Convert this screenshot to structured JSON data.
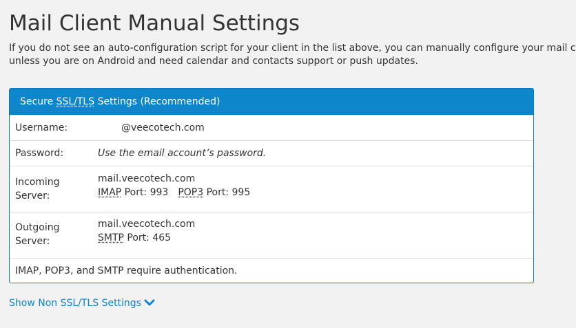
{
  "page": {
    "title": "Mail Client Manual Settings",
    "description_line1": "If you do not see an auto-configuration script for your client in the list above, you can manually configure your mail client using",
    "description_line2": "unless you are on Android and need calendar and contacts support or push updates."
  },
  "panel": {
    "header_prefix": "Secure ",
    "header_abbr": "SSL/TLS",
    "header_suffix": " Settings (Recommended)",
    "username_label": "Username:",
    "username_value": "@veecotech.com",
    "password_label": "Password:",
    "password_value": "Use the email account’s password.",
    "incoming_label": "Incoming Server:",
    "incoming_host": "mail.veecotech.com",
    "imap_abbr": "IMAP",
    "imap_port_text": " Port: 993",
    "pop3_abbr": "POP3",
    "pop3_port_text": " Port: 995",
    "outgoing_label": "Outgoing Server:",
    "outgoing_host": "mail.veecotech.com",
    "smtp_abbr": "SMTP",
    "smtp_port_text": " Port: 465",
    "auth_note": "IMAP, POP3, and SMTP require authentication."
  },
  "toggle": {
    "label": "Show Non SSL/TLS Settings",
    "icon": "chevron-down-icon"
  },
  "colors": {
    "accent": "#0e86cc",
    "background": "#f2f2f2"
  }
}
